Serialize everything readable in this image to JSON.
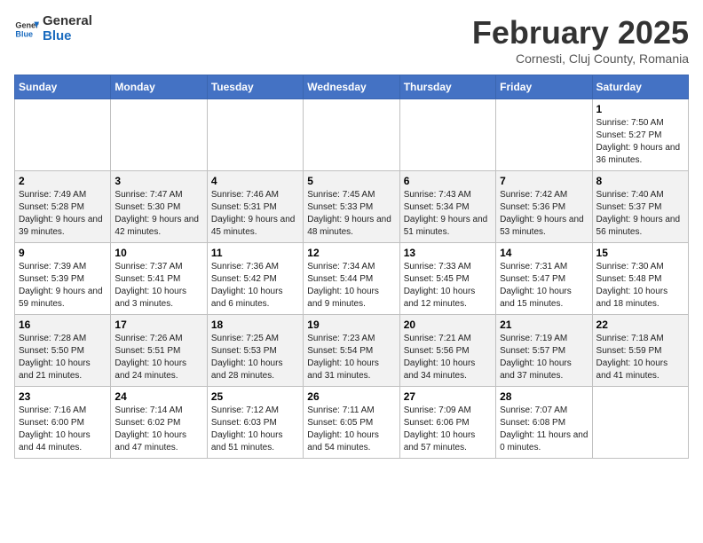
{
  "logo": {
    "line1": "General",
    "line2": "Blue"
  },
  "title": "February 2025",
  "subtitle": "Cornesti, Cluj County, Romania",
  "days_of_week": [
    "Sunday",
    "Monday",
    "Tuesday",
    "Wednesday",
    "Thursday",
    "Friday",
    "Saturday"
  ],
  "weeks": [
    [
      {
        "day": "",
        "info": ""
      },
      {
        "day": "",
        "info": ""
      },
      {
        "day": "",
        "info": ""
      },
      {
        "day": "",
        "info": ""
      },
      {
        "day": "",
        "info": ""
      },
      {
        "day": "",
        "info": ""
      },
      {
        "day": "1",
        "info": "Sunrise: 7:50 AM\nSunset: 5:27 PM\nDaylight: 9 hours and 36 minutes."
      }
    ],
    [
      {
        "day": "2",
        "info": "Sunrise: 7:49 AM\nSunset: 5:28 PM\nDaylight: 9 hours and 39 minutes."
      },
      {
        "day": "3",
        "info": "Sunrise: 7:47 AM\nSunset: 5:30 PM\nDaylight: 9 hours and 42 minutes."
      },
      {
        "day": "4",
        "info": "Sunrise: 7:46 AM\nSunset: 5:31 PM\nDaylight: 9 hours and 45 minutes."
      },
      {
        "day": "5",
        "info": "Sunrise: 7:45 AM\nSunset: 5:33 PM\nDaylight: 9 hours and 48 minutes."
      },
      {
        "day": "6",
        "info": "Sunrise: 7:43 AM\nSunset: 5:34 PM\nDaylight: 9 hours and 51 minutes."
      },
      {
        "day": "7",
        "info": "Sunrise: 7:42 AM\nSunset: 5:36 PM\nDaylight: 9 hours and 53 minutes."
      },
      {
        "day": "8",
        "info": "Sunrise: 7:40 AM\nSunset: 5:37 PM\nDaylight: 9 hours and 56 minutes."
      }
    ],
    [
      {
        "day": "9",
        "info": "Sunrise: 7:39 AM\nSunset: 5:39 PM\nDaylight: 9 hours and 59 minutes."
      },
      {
        "day": "10",
        "info": "Sunrise: 7:37 AM\nSunset: 5:41 PM\nDaylight: 10 hours and 3 minutes."
      },
      {
        "day": "11",
        "info": "Sunrise: 7:36 AM\nSunset: 5:42 PM\nDaylight: 10 hours and 6 minutes."
      },
      {
        "day": "12",
        "info": "Sunrise: 7:34 AM\nSunset: 5:44 PM\nDaylight: 10 hours and 9 minutes."
      },
      {
        "day": "13",
        "info": "Sunrise: 7:33 AM\nSunset: 5:45 PM\nDaylight: 10 hours and 12 minutes."
      },
      {
        "day": "14",
        "info": "Sunrise: 7:31 AM\nSunset: 5:47 PM\nDaylight: 10 hours and 15 minutes."
      },
      {
        "day": "15",
        "info": "Sunrise: 7:30 AM\nSunset: 5:48 PM\nDaylight: 10 hours and 18 minutes."
      }
    ],
    [
      {
        "day": "16",
        "info": "Sunrise: 7:28 AM\nSunset: 5:50 PM\nDaylight: 10 hours and 21 minutes."
      },
      {
        "day": "17",
        "info": "Sunrise: 7:26 AM\nSunset: 5:51 PM\nDaylight: 10 hours and 24 minutes."
      },
      {
        "day": "18",
        "info": "Sunrise: 7:25 AM\nSunset: 5:53 PM\nDaylight: 10 hours and 28 minutes."
      },
      {
        "day": "19",
        "info": "Sunrise: 7:23 AM\nSunset: 5:54 PM\nDaylight: 10 hours and 31 minutes."
      },
      {
        "day": "20",
        "info": "Sunrise: 7:21 AM\nSunset: 5:56 PM\nDaylight: 10 hours and 34 minutes."
      },
      {
        "day": "21",
        "info": "Sunrise: 7:19 AM\nSunset: 5:57 PM\nDaylight: 10 hours and 37 minutes."
      },
      {
        "day": "22",
        "info": "Sunrise: 7:18 AM\nSunset: 5:59 PM\nDaylight: 10 hours and 41 minutes."
      }
    ],
    [
      {
        "day": "23",
        "info": "Sunrise: 7:16 AM\nSunset: 6:00 PM\nDaylight: 10 hours and 44 minutes."
      },
      {
        "day": "24",
        "info": "Sunrise: 7:14 AM\nSunset: 6:02 PM\nDaylight: 10 hours and 47 minutes."
      },
      {
        "day": "25",
        "info": "Sunrise: 7:12 AM\nSunset: 6:03 PM\nDaylight: 10 hours and 51 minutes."
      },
      {
        "day": "26",
        "info": "Sunrise: 7:11 AM\nSunset: 6:05 PM\nDaylight: 10 hours and 54 minutes."
      },
      {
        "day": "27",
        "info": "Sunrise: 7:09 AM\nSunset: 6:06 PM\nDaylight: 10 hours and 57 minutes."
      },
      {
        "day": "28",
        "info": "Sunrise: 7:07 AM\nSunset: 6:08 PM\nDaylight: 11 hours and 0 minutes."
      },
      {
        "day": "",
        "info": ""
      }
    ]
  ]
}
